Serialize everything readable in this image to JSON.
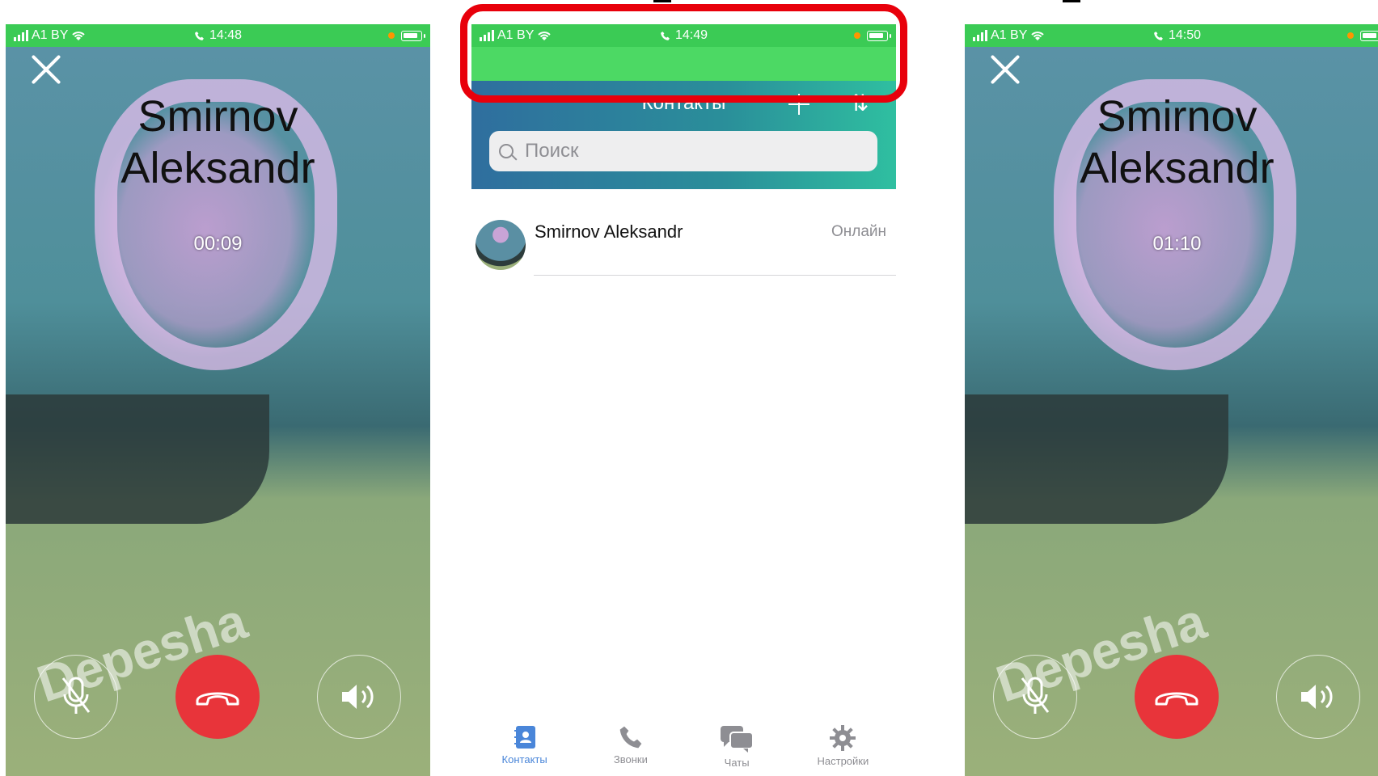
{
  "left_screen": {
    "status": {
      "carrier": "A1 BY",
      "time": "14:48"
    },
    "caller_first": "Smirnov",
    "caller_last": "Aleksandr",
    "timer": "00:09",
    "watermark": "Depesha"
  },
  "middle_screen": {
    "status": {
      "carrier": "A1 BY",
      "time": "14:49"
    },
    "header_title": "Контакты",
    "search_placeholder": "Поиск",
    "contacts": [
      {
        "name": "Smirnov Aleksandr",
        "status": "Онлайн"
      }
    ],
    "tabs": [
      {
        "label": "Контакты",
        "icon": "contacts-book-icon",
        "active": true
      },
      {
        "label": "Звонки",
        "icon": "phone-icon",
        "active": false
      },
      {
        "label": "Чаты",
        "icon": "chat-bubbles-icon",
        "active": false
      },
      {
        "label": "Настройки",
        "icon": "gear-icon",
        "active": false
      }
    ]
  },
  "right_screen": {
    "status": {
      "carrier": "A1 BY",
      "time": "14:50"
    },
    "caller_first": "Smirnov",
    "caller_last": "Aleksandr",
    "timer": "01:10",
    "watermark": "Depesha"
  },
  "colors": {
    "status_bar": "#3bcb55",
    "hangup": "#e8343a",
    "highlight": "#e8000b",
    "active_tab": "#4a86d9"
  }
}
